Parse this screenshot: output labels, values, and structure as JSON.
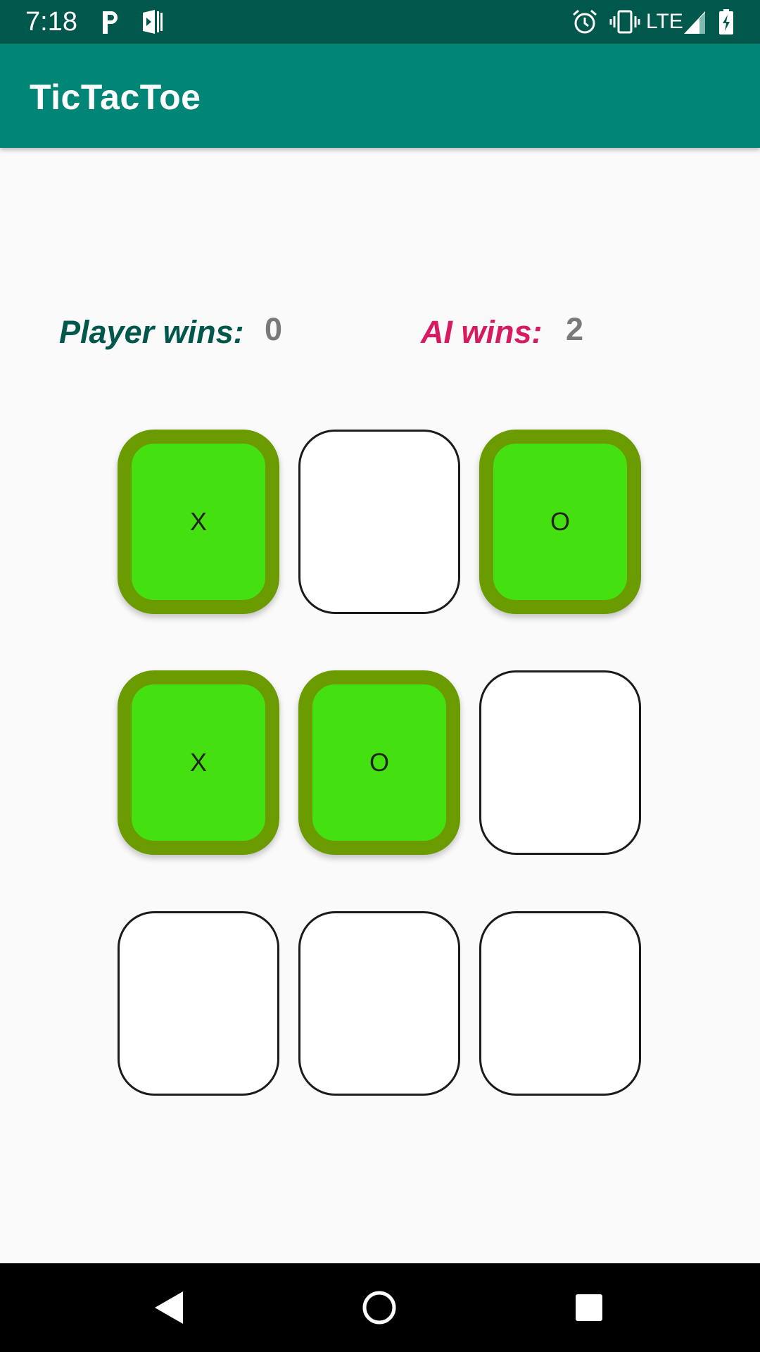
{
  "status_bar": {
    "time": "7:18",
    "network": "LTE",
    "icons": [
      "parking-icon",
      "play-store-icon",
      "alarm-icon",
      "vibrate-icon",
      "signal-icon",
      "battery-charging-icon"
    ]
  },
  "app_bar": {
    "title": "TicTacToe",
    "color": "#008577"
  },
  "score": {
    "player_label": "Player wins:",
    "player_value": "0",
    "ai_label": "AI wins:",
    "ai_value": "2",
    "player_color": "#00574b",
    "ai_color": "#d81b60"
  },
  "board": {
    "cells": [
      "X",
      "",
      "O",
      "X",
      "O",
      "",
      "",
      "",
      ""
    ],
    "marked_fill": "#45e00f",
    "marked_border": "#6a9b00"
  },
  "nav_bar": {
    "icons": [
      "back-icon",
      "home-icon",
      "recents-icon"
    ]
  }
}
